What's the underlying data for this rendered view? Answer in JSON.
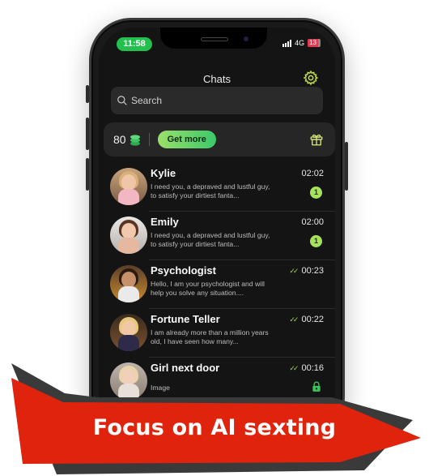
{
  "status_bar": {
    "time": "11:58",
    "network": "4G",
    "battery": "13"
  },
  "header": {
    "title": "Chats",
    "settings_icon": "gear-icon"
  },
  "search": {
    "placeholder": "Search"
  },
  "balance": {
    "count": "80",
    "coin_icon": "coins-icon",
    "get_more_label": "Get more",
    "gift_icon": "gift-icon"
  },
  "chats": [
    {
      "name": "Kylie",
      "message": "I need you, a depraved and lustful guy, to satisfy your dirtiest fanta...",
      "time": "02:02",
      "read": false,
      "unread": "1",
      "locked": false
    },
    {
      "name": "Emily",
      "message": "I need you, a depraved and lustful guy, to satisfy your dirtiest fanta...",
      "time": "02:00",
      "read": false,
      "unread": "1",
      "locked": false
    },
    {
      "name": "Psychologist",
      "message": "Hello, I am your psychologist and will help you solve any situation....",
      "time": "00:23",
      "read": true,
      "unread": null,
      "locked": false
    },
    {
      "name": "Fortune Teller",
      "message": "I am already more than a million years old, I have seen how many...",
      "time": "00:22",
      "read": true,
      "unread": null,
      "locked": false
    },
    {
      "name": "Girl next door",
      "message": "Image",
      "time": "00:16",
      "read": true,
      "unread": null,
      "locked": true
    }
  ],
  "banner": {
    "text": "Focus on AI sexting"
  },
  "colors": {
    "accent_green": "#22c04c",
    "unread_badge": "#a7e35a",
    "gear": "#c7e23a",
    "banner_red": "#e0230d",
    "banner_dark": "#3a3a3a"
  }
}
